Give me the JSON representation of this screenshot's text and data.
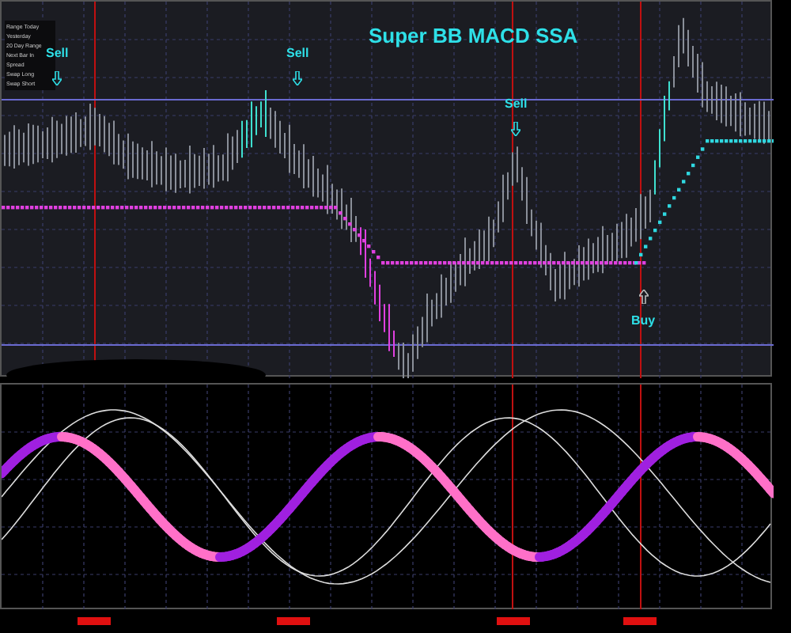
{
  "chart": {
    "title": "Super BB MACD SSA",
    "signals": [
      {
        "kind": "sell",
        "label": "Sell"
      },
      {
        "kind": "sell",
        "label": "Sell"
      },
      {
        "kind": "sell",
        "label": "Sell"
      },
      {
        "kind": "buy",
        "label": "Buy"
      }
    ]
  },
  "info_panel": {
    "labels": [
      "Range Today",
      "Yesterday",
      "20 Day Range",
      "Next Bar In",
      "Spread",
      "Swap Long",
      "Swap Short"
    ]
  }
}
